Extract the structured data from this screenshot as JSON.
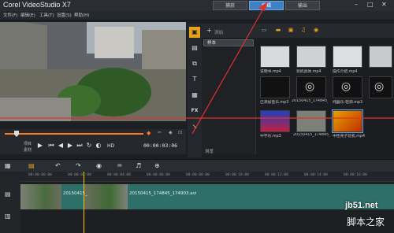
{
  "app": {
    "title": "Corel VideoStudio X7"
  },
  "tabs": [
    {
      "label": "捕获",
      "active": false
    },
    {
      "label": "编辑",
      "active": true
    },
    {
      "label": "输出",
      "active": false
    }
  ],
  "menu": [
    "文件(F)",
    "编辑(E)",
    "工具(T)",
    "设置(S)",
    "帮助(H)"
  ],
  "player": {
    "timecode": "00:00:03:06",
    "project_label": "项目",
    "clip_label": "素材",
    "hd_label": "HD"
  },
  "library": {
    "add_label": "添加",
    "folder": "样本",
    "browse_label": "浏览",
    "items": [
      {
        "label": "",
        "kind": "video"
      },
      {
        "label": "",
        "kind": "video"
      },
      {
        "label": "",
        "kind": "video"
      },
      {
        "label": "说明书.mp4",
        "kind": "video"
      },
      {
        "label": "装机具体.mp4",
        "kind": "video"
      },
      {
        "label": "操作介绍.mp4",
        "kind": "video"
      },
      {
        "label": "已添加音乐.mp3",
        "kind": "audio"
      },
      {
        "label": "20150415_174845_174903.avi",
        "kind": "video"
      },
      {
        "label": "纯器乐-轻调.mp3",
        "kind": "audio"
      },
      {
        "label": "中学乐.mp3",
        "kind": "image"
      },
      {
        "label": "20150415_174845_...",
        "kind": "video"
      },
      {
        "label": "中性壳子装机.mp4",
        "kind": "video"
      }
    ]
  },
  "timeline": {
    "ruler": [
      "00:00:00:00",
      "00:00:02:00",
      "00:00:04:00",
      "00:00:06:00",
      "00:00:08:00",
      "00:00:10:00",
      "00:00:12:00",
      "00:00:14:00",
      "00:00:16:00"
    ],
    "clips": [
      {
        "label": "20150415_"
      },
      {
        "label": "20150415_174845_174903.avi"
      }
    ]
  },
  "watermark": {
    "line1": "jb51.net",
    "line2": "脚本之家"
  },
  "colors": {
    "accent": "#3f82c4",
    "scrub": "#ff7a1a",
    "annotation": "#e23030",
    "track": "#2e6f6a"
  }
}
